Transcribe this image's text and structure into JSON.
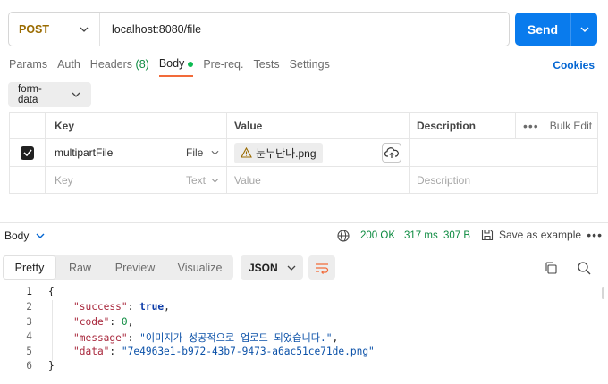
{
  "request": {
    "method": "POST",
    "url": "localhost:8080/file",
    "send_label": "Send"
  },
  "tabs": [
    {
      "label": "Params"
    },
    {
      "label": "Auth"
    },
    {
      "label": "Headers",
      "count": "(8)"
    },
    {
      "label": "Body",
      "active": true
    },
    {
      "label": "Pre-req."
    },
    {
      "label": "Tests"
    },
    {
      "label": "Settings"
    }
  ],
  "cookies_label": "Cookies",
  "body_mode": "form-data",
  "params_table": {
    "headers": {
      "key": "Key",
      "value": "Value",
      "description": "Description",
      "bulk_edit": "Bulk Edit"
    },
    "row1": {
      "checked": true,
      "key": "multipartFile",
      "type": "File",
      "value": "눈누난나.png"
    },
    "row2": {
      "key_placeholder": "Key",
      "type_placeholder": "Text",
      "value_placeholder": "Value",
      "description_placeholder": "Description"
    }
  },
  "response": {
    "body_label": "Body",
    "status": "200 OK",
    "time": "317 ms",
    "size": "307 B",
    "save_example": "Save as example",
    "view_tabs": [
      "Pretty",
      "Raw",
      "Preview",
      "Visualize"
    ],
    "active_view": "Pretty",
    "format": "JSON",
    "line_numbers": [
      "1",
      "2",
      "3",
      "4",
      "5",
      "6"
    ],
    "json": {
      "open": "{",
      "close": "}",
      "success_key": "\"success\"",
      "success_val": "true",
      "code_key": "\"code\"",
      "code_val": "0",
      "message_key": "\"message\"",
      "message_val": "\"이미지가 성공적으로 업로드 되었습니다.\"",
      "data_key": "\"data\"",
      "data_val": "\"7e4963e1-b972-43b7-9473-a6ac51ce71de.png\""
    }
  },
  "icons": {
    "method_dropdown": "chevron-down-icon",
    "send_dropdown": "chevron-down-icon",
    "upload": "cloud-upload-icon",
    "file_warning": "warning-icon",
    "globe": "globe-icon",
    "save": "save-icon",
    "wrap": "wrap-lines-icon",
    "copy": "copy-icon",
    "search": "search-icon"
  },
  "colors": {
    "send": "#097bed",
    "method": "#9a6b00",
    "status": "#0b8a3f",
    "active_tab_underline": "#f26b3a",
    "cookies": "#0265d2"
  }
}
